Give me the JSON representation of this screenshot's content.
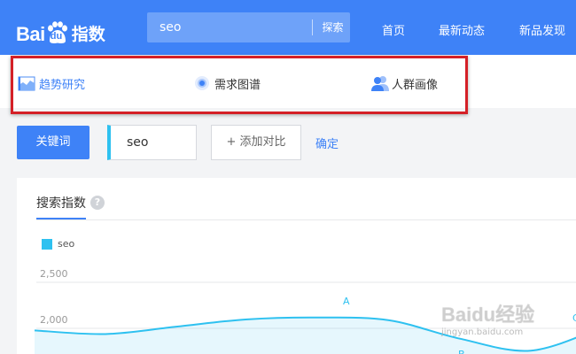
{
  "header": {
    "logo_text_bai": "Bai",
    "logo_text_du": "du",
    "logo_text_zhi": "指数",
    "search_value": "seo",
    "search_button": "探索",
    "nav": [
      "首页",
      "最新动态",
      "新品发现"
    ]
  },
  "tabs": [
    {
      "label": "趋势研究",
      "icon": "trend-icon",
      "active": true
    },
    {
      "label": "需求图谱",
      "icon": "target-icon",
      "active": false
    },
    {
      "label": "人群画像",
      "icon": "people-icon",
      "active": false
    }
  ],
  "keyword_row": {
    "keyword_button": "关键词",
    "keyword_value": "seo",
    "add_compare": "+ 添加对比",
    "confirm": "确定"
  },
  "panel": {
    "title": "搜索指数",
    "help": "?",
    "legend": "seo"
  },
  "chart_data": {
    "type": "line",
    "series": [
      {
        "name": "seo",
        "points": [
          [
            0,
            1920
          ],
          [
            1,
            1880
          ],
          [
            2,
            1960
          ],
          [
            3,
            2040
          ],
          [
            4,
            2060
          ],
          [
            5,
            2030
          ],
          [
            6,
            1830
          ],
          [
            7,
            1700
          ],
          [
            8,
            1950
          ]
        ]
      }
    ],
    "ytick_labels": [
      "2,500",
      "2,000"
    ],
    "yticks": [
      2500,
      2000
    ],
    "annotations": [
      "A",
      "B",
      "C"
    ],
    "color": "#2ec1f0"
  },
  "colors": {
    "brand": "#3e82f7",
    "series": "#2ec1f0",
    "highlight": "#d42027"
  },
  "watermark": {
    "line1": "Baidu经验",
    "line2": "jingyan.baidu.com"
  }
}
